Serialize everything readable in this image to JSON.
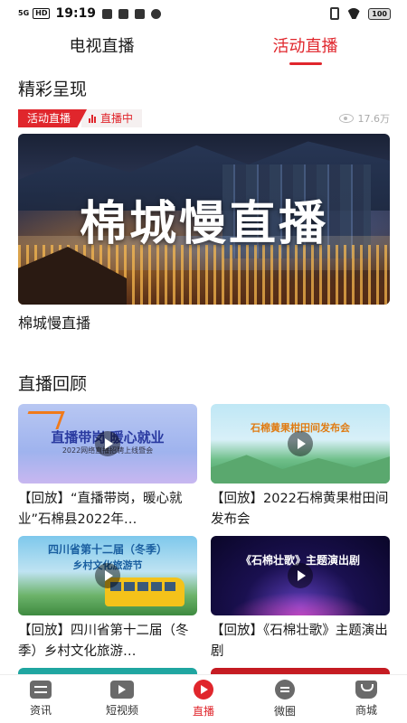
{
  "status_bar": {
    "signal": "5G",
    "hd": "HD",
    "time": "19:19",
    "battery": "100"
  },
  "tabs": [
    {
      "label": "电视直播",
      "active": false
    },
    {
      "label": "活动直播",
      "active": true
    }
  ],
  "featured": {
    "section_title": "精彩呈现",
    "category_badge": "活动直播",
    "live_badge": "直播中",
    "views": "17.6万",
    "image_title": "棉城慢直播",
    "caption": "棉城慢直播"
  },
  "replay": {
    "section_title": "直播回顾",
    "items": [
      {
        "title": "【回放】“直播带岗，暖心就业”石棉县2022年…",
        "thumb_text": "直播带岗 暖心就业",
        "thumb_sub": "2022网络直播招聘上线暨会"
      },
      {
        "title": "【回放】2022石棉黄果柑田间发布会",
        "thumb_text": "石棉黄果柑田间发布会"
      },
      {
        "title": "【回放】四川省第十二届（冬季）乡村文化旅游…",
        "thumb_text": "四川省第十二届（冬季）",
        "thumb_sub": "乡村文化旅游节"
      },
      {
        "title": "【回放】《石棉壮歌》主题演出剧",
        "thumb_text": "《石棉壮歌》主题演出剧"
      }
    ]
  },
  "bottom_nav": [
    {
      "label": "资讯",
      "icon": "news-icon",
      "active": false
    },
    {
      "label": "短视频",
      "icon": "video-camera-icon",
      "active": false
    },
    {
      "label": "直播",
      "icon": "live-play-icon",
      "active": true
    },
    {
      "label": "微圈",
      "icon": "chat-circle-icon",
      "active": false
    },
    {
      "label": "商城",
      "icon": "shopping-bag-icon",
      "active": false
    }
  ],
  "colors": {
    "accent": "#e0262c",
    "text": "#1a1a1a",
    "muted": "#aaaaaa"
  }
}
